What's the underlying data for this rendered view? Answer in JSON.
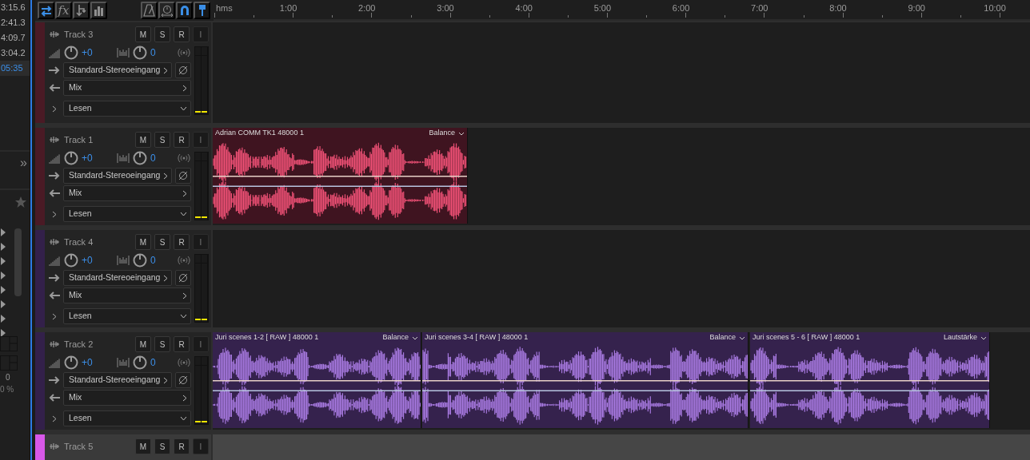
{
  "left_panel": {
    "times": [
      {
        "text": "3:15.6",
        "selected": false
      },
      {
        "text": "2:41.3",
        "selected": false
      },
      {
        "text": "4:09.7",
        "selected": false
      },
      {
        "text": "3:04.2",
        "selected": false
      },
      {
        "text": "05:35",
        "selected": true
      }
    ],
    "expand": "»",
    "bottom_value": "0",
    "bottom_percent": "0 %"
  },
  "toolbar": [
    {
      "kind": "loop",
      "on": true
    },
    {
      "kind": "fx",
      "label": "fx",
      "on": false
    },
    {
      "kind": "routing",
      "on": false
    },
    {
      "kind": "meter",
      "on": false
    },
    {
      "kind": "metronome",
      "on": false
    },
    {
      "kind": "timer",
      "on": false
    },
    {
      "kind": "snap",
      "on": true
    },
    {
      "kind": "pin",
      "on": true
    }
  ],
  "ruler": {
    "unit": "hms",
    "ticks": [
      "1:00",
      "2:00",
      "3:00",
      "4:00",
      "5:00",
      "6:00",
      "7:00",
      "8:00",
      "9:00",
      "10:00"
    ]
  },
  "tracks": [
    {
      "name": "Track 3",
      "color": "#4a1a25",
      "selected": false,
      "buttons": [
        {
          "label": "M",
          "disabled": false
        },
        {
          "label": "S",
          "disabled": false
        },
        {
          "label": "R",
          "disabled": false
        },
        {
          "label": "I",
          "disabled": true
        }
      ],
      "volume": "+0",
      "pan": "0",
      "input": "Standard-Stereoeingang",
      "output": "Mix",
      "automation": "Lesen",
      "meter": [
        {
          "level": 0.02
        },
        {
          "level": 0.02
        }
      ]
    },
    {
      "name": "Track 1",
      "color": "#4a1a25",
      "selected": false,
      "buttons": [
        {
          "label": "M",
          "disabled": false
        },
        {
          "label": "S",
          "disabled": false
        },
        {
          "label": "R",
          "disabled": false
        },
        {
          "label": "I",
          "disabled": true
        }
      ],
      "volume": "+0",
      "pan": "0",
      "input": "Standard-Stereoeingang",
      "output": "Mix",
      "automation": "Lesen",
      "meter": [
        {
          "level": 0.02
        },
        {
          "level": 0.02
        }
      ],
      "clips": [
        {
          "name": "Adrian COMM TK1 48000 1",
          "envelope": "Balance",
          "color": "#ee5075"
        }
      ]
    },
    {
      "name": "Track 4",
      "color": "#33204a",
      "selected": false,
      "buttons": [
        {
          "label": "M",
          "disabled": false
        },
        {
          "label": "S",
          "disabled": false
        },
        {
          "label": "R",
          "disabled": false
        },
        {
          "label": "I",
          "disabled": true
        }
      ],
      "volume": "+0",
      "pan": "0",
      "input": "Standard-Stereoeingang",
      "output": "Mix",
      "automation": "Lesen",
      "meter": [
        {
          "level": 0.02
        },
        {
          "level": 0.02
        }
      ]
    },
    {
      "name": "Track 2",
      "color": "#33204a",
      "selected": false,
      "buttons": [
        {
          "label": "M",
          "disabled": false
        },
        {
          "label": "S",
          "disabled": false
        },
        {
          "label": "R",
          "disabled": false
        },
        {
          "label": "I",
          "disabled": true
        }
      ],
      "volume": "+0",
      "pan": "0",
      "input": "Standard-Stereoeingang",
      "output": "Mix",
      "automation": "Lesen",
      "meter": [
        {
          "level": 0.02
        },
        {
          "level": 0.02
        }
      ],
      "clips": [
        {
          "name": "Juri scenes 1-2 [ RAW ] 48000 1",
          "envelope": "Balance",
          "color": "#a779e0"
        },
        {
          "name": "Juri scenes 3-4 [ RAW ] 48000 1",
          "envelope": "Balance",
          "color": "#a779e0"
        },
        {
          "name": "Juri scenes 5 - 6 [ RAW ] 48000 1",
          "envelope": "Lautstärke",
          "color": "#a779e0"
        }
      ]
    },
    {
      "name": "Track 5",
      "color": "#d858e8",
      "selected": true,
      "buttons": [
        {
          "label": "M",
          "disabled": false
        },
        {
          "label": "S",
          "disabled": false
        },
        {
          "label": "R",
          "disabled": false
        },
        {
          "label": "I",
          "disabled": true
        }
      ]
    }
  ]
}
